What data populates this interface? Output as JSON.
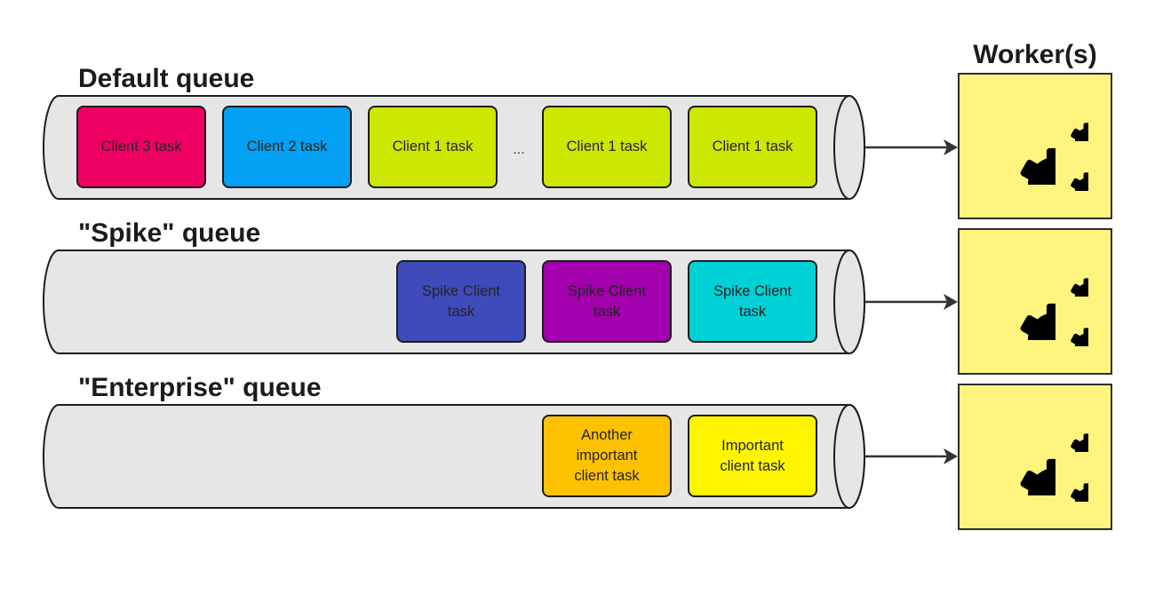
{
  "colors": {
    "queue_fill": "#E6E6E6",
    "worker_fill": "#FFF47E",
    "outline": "#1e1e1e",
    "arrow": "#333333"
  },
  "workers_heading": "Worker(s)",
  "queues": [
    {
      "title": "Default queue",
      "ellipsis": "...",
      "tasks": [
        {
          "label": "Client 3 task",
          "color": "#EE0062"
        },
        {
          "label": "Client 2 task",
          "color": "#03A0F3"
        },
        {
          "label": "Client 1 task",
          "color": "#CDE700"
        },
        {
          "label": "Client 1 task",
          "color": "#CDE700"
        },
        {
          "label": "Client 1 task",
          "color": "#CDE700"
        }
      ]
    },
    {
      "title": "\"Spike\" queue",
      "tasks": [
        {
          "label": "Spike Client task",
          "color": "#3F4BBA"
        },
        {
          "label": "Spike Client task",
          "color": "#A100AC"
        },
        {
          "label": "Spike Client task",
          "color": "#00D1D6"
        }
      ]
    },
    {
      "title": "\"Enterprise\" queue",
      "tasks": [
        {
          "label": "Another important client task",
          "color": "#FFC200"
        },
        {
          "label": "Important client task",
          "color": "#FFF500"
        }
      ]
    }
  ],
  "workers": [
    {
      "icon": "gears-icon"
    },
    {
      "icon": "gears-icon"
    },
    {
      "icon": "gears-icon"
    }
  ]
}
